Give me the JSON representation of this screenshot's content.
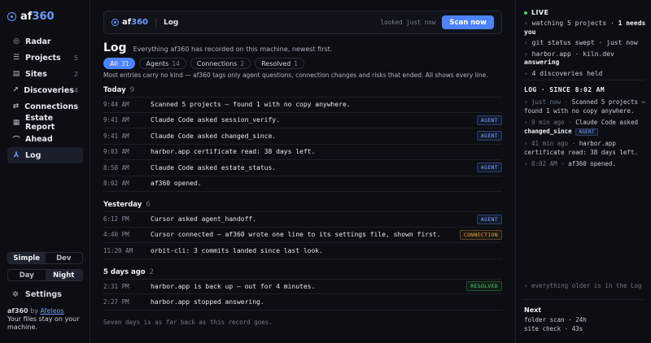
{
  "brand": {
    "prefix": "af",
    "suffix": "360"
  },
  "sidebar": {
    "items": [
      {
        "label": "Radar",
        "count": "",
        "icon": "radar-icon"
      },
      {
        "label": "Projects",
        "count": "5",
        "icon": "projects-icon"
      },
      {
        "label": "Sites",
        "count": "2",
        "icon": "sites-icon"
      },
      {
        "label": "Discoveries",
        "count": "4",
        "icon": "discoveries-icon"
      },
      {
        "label": "Connections",
        "count": "",
        "icon": "connections-icon"
      },
      {
        "label": "Estate Report",
        "count": "",
        "icon": "report-icon"
      },
      {
        "label": "Ahead",
        "count": "",
        "icon": "ahead-icon"
      },
      {
        "label": "Log",
        "count": "",
        "icon": "log-icon",
        "active": true
      }
    ],
    "mode": {
      "simple": "Simple",
      "dev": "Dev",
      "selected": "Simple"
    },
    "theme": {
      "day": "Day",
      "night": "Night",
      "selected": "Night"
    },
    "settings": "Settings",
    "footer": {
      "app": "af360",
      "by": "by",
      "author": "Afeleos",
      "tagline": "Your files stay on your machine."
    }
  },
  "topbar": {
    "crumb": "Log",
    "looked": "looked just now",
    "scan_label": "Scan now"
  },
  "page": {
    "title": "Log",
    "subtitle": "Everything af360 has recorded on this machine, newest first.",
    "filters": [
      {
        "label": "All",
        "count": "31",
        "active": true
      },
      {
        "label": "Agents",
        "count": "14"
      },
      {
        "label": "Connections",
        "count": "2"
      },
      {
        "label": "Resolved",
        "count": "1"
      }
    ],
    "note": "Most entries carry no kind — af360 tags only agent questions, connection changes and risks that ended. All shows every line.",
    "groups": [
      {
        "label": "Today",
        "count": "9",
        "rows": [
          {
            "time": "9:44 AM",
            "text": "Scanned 5 projects — found 1 with no copy anywhere.",
            "tag": ""
          },
          {
            "time": "9:41 AM",
            "text": "Claude Code asked session_verify.",
            "tag": "AGENT"
          },
          {
            "time": "9:41 AM",
            "text": "Claude Code asked changed_since.",
            "tag": "AGENT"
          },
          {
            "time": "9:03 AM",
            "text": "harbor.app certificate read: 38 days left.",
            "tag": ""
          },
          {
            "time": "8:58 AM",
            "text": "Claude Code asked estate_status.",
            "tag": "AGENT"
          },
          {
            "time": "8:02 AM",
            "text": "af360 opened.",
            "tag": ""
          }
        ]
      },
      {
        "label": "Yesterday",
        "count": "6",
        "rows": [
          {
            "time": "6:12 PM",
            "text": "Cursor asked agent_handoff.",
            "tag": "AGENT"
          },
          {
            "time": "4:40 PM",
            "text": "Cursor connected — af360 wrote one line to its settings file, shown first.",
            "tag": "CONNECTION"
          },
          {
            "time": "11:20 AM",
            "text": "orbit-cli: 3 commits landed since last look.",
            "tag": ""
          }
        ]
      },
      {
        "label": "5 days ago",
        "count": "2",
        "rows": [
          {
            "time": "2:31 PM",
            "text": "harbor.app is back up — out for 4 minutes.",
            "tag": "RESOLVED"
          },
          {
            "time": "2:27 PM",
            "text": "harbor.app stopped answering.",
            "tag": ""
          }
        ]
      }
    ],
    "endnote": "Seven days is as far back as this record goes."
  },
  "panel": {
    "live_title": "LIVE",
    "live": [
      {
        "pre": "watching 5 projects · ",
        "bold": "1 needs you",
        "post": ""
      },
      {
        "pre": "git status swept · just now",
        "bold": "",
        "post": ""
      },
      {
        "pre": "harbor.app · kiln.dev ",
        "bold": "answering",
        "post": ""
      },
      {
        "pre": "4 discoveries held",
        "bold": "",
        "post": ""
      }
    ],
    "log_title": "LOG · SINCE 8:02 AM",
    "log": [
      {
        "when": "just now",
        "text": "Scanned 5 projects — found 1 with no copy anywhere.",
        "bold": "",
        "tag": ""
      },
      {
        "when": "9 min ago",
        "text": "Claude Code asked ",
        "bold": "changed_since",
        "tag": "AGENT"
      },
      {
        "when": "41 min ago",
        "text": "harbor.app certificate read: 38 days left.",
        "bold": "",
        "tag": ""
      },
      {
        "when": "8:02 AM",
        "text": "af360 opened.",
        "bold": "",
        "tag": ""
      }
    ],
    "older": "everything older is in the Log",
    "next_title": "Next",
    "next": [
      "folder scan · 24h",
      "site check · 43s"
    ]
  },
  "colors": {
    "accent": "#4d83ff",
    "live": "#43d17a",
    "agent": "#7aa2ff",
    "connection": "#e3a64a",
    "resolved": "#4ccf7a"
  }
}
